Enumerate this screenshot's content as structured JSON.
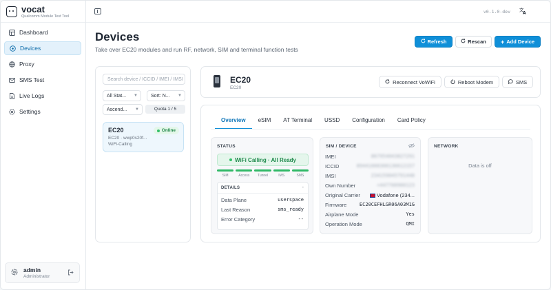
{
  "brand": {
    "name": "vocat",
    "subtitle": "Qualcomm Module Test Tool"
  },
  "topbar": {
    "version": "v0.1.0-dev",
    "lang_icon": "translate-icon"
  },
  "sidebar": {
    "items": [
      {
        "label": "Dashboard",
        "icon": "dashboard-icon"
      },
      {
        "label": "Devices",
        "icon": "devices-icon",
        "active": true
      },
      {
        "label": "Proxy",
        "icon": "globe-icon"
      },
      {
        "label": "SMS Test",
        "icon": "mail-icon"
      },
      {
        "label": "Live Logs",
        "icon": "file-icon"
      },
      {
        "label": "Settings",
        "icon": "gear-icon"
      }
    ],
    "user": {
      "name": "admin",
      "role": "Administrator"
    }
  },
  "header": {
    "title": "Devices",
    "subtitle": "Take over EC20 modules and run RF, network, SIM and terminal function tests",
    "refresh": "Refresh",
    "rescan": "Rescan",
    "add_device": "Add Device"
  },
  "list": {
    "search_placeholder": "Search device / ICCID / IMEI / IMSI",
    "status_filter": "All Stat...",
    "sort": "Sort: N...",
    "order": "Ascend...",
    "quota": "Quota 1 / 5",
    "device": {
      "name": "EC20",
      "meta": "EC20 · wwp0s20f...",
      "mode": "WiFi-Calling",
      "status": "Online"
    }
  },
  "detail": {
    "title": "EC20",
    "subtitle": "EC20",
    "reconnect": "Reconnect VoWiFi",
    "reboot": "Reboot Modem",
    "sms": "SMS"
  },
  "tabs": [
    "Overview",
    "eSIM",
    "AT Terminal",
    "USSD",
    "Configuration",
    "Card Policy"
  ],
  "status_card": {
    "heading": "STATUS",
    "state": "WiFi Calling · All Ready",
    "segments": [
      "SIM",
      "Access",
      "Tunnel",
      "IMS",
      "SMS"
    ],
    "details_heading": "DETAILS",
    "details_collapse": "-",
    "rows": [
      {
        "k": "Data Plane",
        "v": "userspace"
      },
      {
        "k": "Last Reason",
        "v": "sms_ready"
      },
      {
        "k": "Error Category",
        "v": "--"
      }
    ]
  },
  "sim_card": {
    "heading": "SIM / DEVICE",
    "rows": [
      {
        "k": "IMEI",
        "v": "867954043827291",
        "blur": true
      },
      {
        "k": "ICCID",
        "v": "89441000300136612157",
        "blur": true
      },
      {
        "k": "IMSI",
        "v": "234159045791448",
        "blur": true
      },
      {
        "k": "Own Number",
        "v": "+447700900123",
        "blur": true
      },
      {
        "k": "Original Carrier",
        "v": "Vodafone (234...",
        "flag": true
      },
      {
        "k": "Firmware",
        "v": "EC20CEFHLGR06A03M1G"
      },
      {
        "k": "Airplane Mode",
        "v": "Yes"
      },
      {
        "k": "Operation Mode",
        "v": "QMI"
      }
    ]
  },
  "network_card": {
    "heading": "NETWORK",
    "empty": "Data is off"
  },
  "colors": {
    "accent": "#0f8fd8",
    "success": "#2fb866"
  }
}
